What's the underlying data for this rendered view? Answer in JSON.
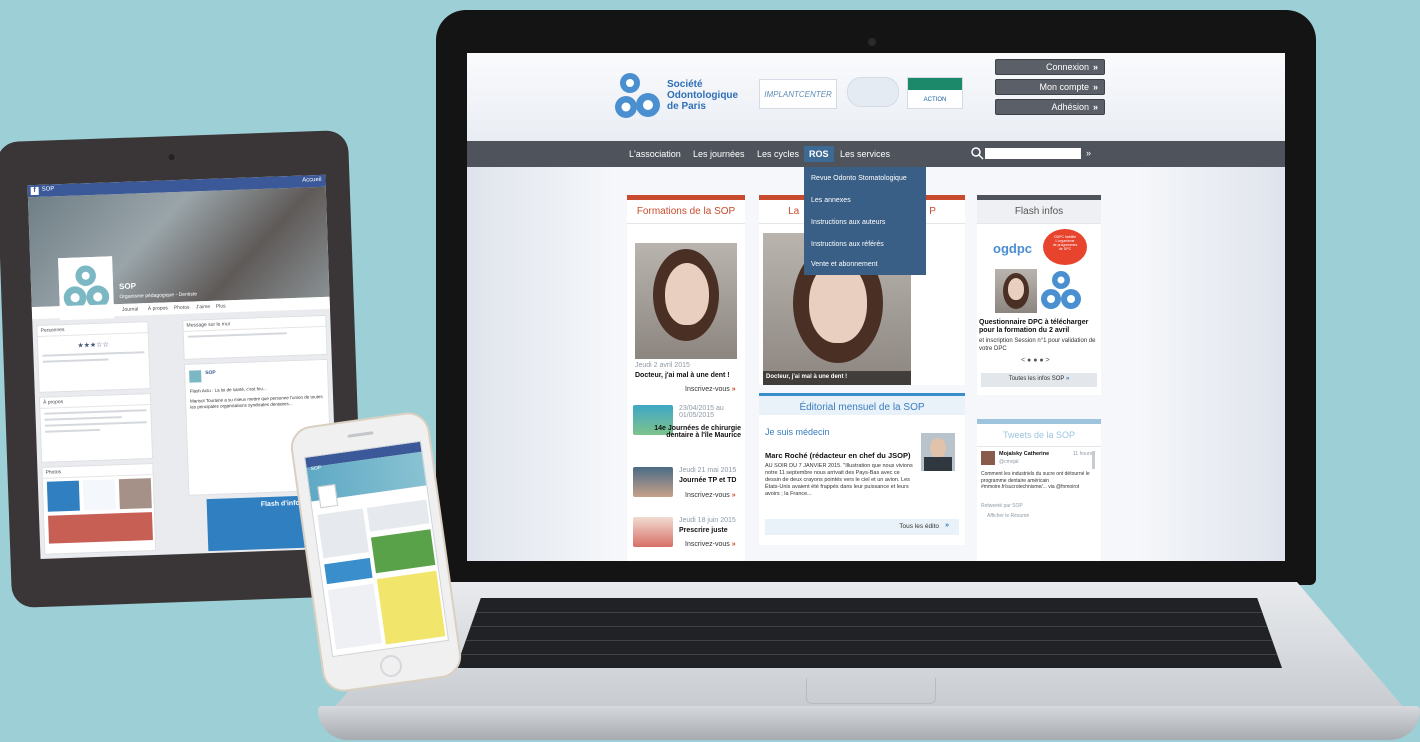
{
  "laptop": {
    "site": {
      "logo_name": "Société\nOdontologique\nde Paris",
      "sponsors": [
        "IMPLANTCENTER",
        "",
        "ACTION"
      ],
      "account_buttons": [
        "Connexion",
        "Mon compte",
        "Adhésion"
      ],
      "nav": [
        "L'association",
        "Les journées",
        "Les cycles",
        "ROS",
        "Les services"
      ],
      "ros_menu": [
        "Revue Odonto Stomatologique",
        "Les annexes",
        "Instructions aux auteurs",
        "Instructions aux référés",
        "Vente et abonnement"
      ],
      "col_left": {
        "heading": "Formations de la SOP",
        "featured_date": "Jeudi 2 avril 2015",
        "featured_title": "Docteur, j'ai mal à une dent !",
        "featured_link": "Inscrivez-vous",
        "events": [
          {
            "date": "23/04/2015 au 01/05/2015",
            "title": "14e Journées de chirurgie dentaire à l'île Maurice",
            "link": ""
          },
          {
            "date": "Jeudi 21 mai 2015",
            "title": "Journée TP et TD",
            "link": "Inscrivez-vous"
          },
          {
            "date": "Jeudi 18 juin 2015",
            "title": "Prescrire juste",
            "link": "Inscrivez-vous"
          }
        ]
      },
      "col_mid": {
        "heading_prefix": "La",
        "heading_suffix": "P",
        "photo_caption": "Docteur, j'ai mal à une dent !",
        "editorial_heading": "Éditorial mensuel de la SOP",
        "editorial_title": "Je suis médecin",
        "editorial_author": "Marc Roché (rédacteur en chef du JSOP)",
        "editorial_text": "AU SOIR DU 7 JANVIER 2015. \"Illustration que nous vivions notre 11 septembre nous arrivait des Pays-Bas avec ce dessin de deux crayons pointés vers le ciel et un avion. Les États-Unis avaient été frappés dans leur puissance et leurs avoirs ; la France...",
        "editorial_link": "Tous les édito"
      },
      "col_right": {
        "heading": "Flash infos",
        "logo_text": "ogdpc",
        "badge_text": "ODPC habilité\nL'organisme\nde programmes\nde DPC",
        "news_title": "Questionnaire DPC à télécharger pour la formation du 2 avril",
        "news_text": "et inscription Session n°1 pour validation de votre DPC",
        "pager": "< ● ● ● >",
        "all_news": "Toutes les infos SOP",
        "tweets_heading": "Tweets de la SOP",
        "tweet_author": "Mojalsky Catherine",
        "tweet_handle": "@cmojal",
        "tweet_time": "11 hours",
        "tweet_text": "Comment les industriels du sucre ont détourné le programme dentaire américain #mmoire.fr/sucrotechnisme/... via @fnmoirot",
        "retweet": "Retweeté par SOP",
        "show_summary": "Afficher le Résumé"
      }
    }
  },
  "tablet": {
    "page_name": "SOP",
    "home": "Accueil",
    "title": "SOP",
    "subtitle": "Organisme pédagogique - Dentiste",
    "tabs": [
      "Journal",
      "À propos",
      "Photos",
      "J'aime",
      "Plus"
    ],
    "rating": "★★★☆☆",
    "cards": [
      "Personnes",
      "À propos",
      "Photos"
    ],
    "composer": "Message sur le mur",
    "post_author": "SOP",
    "post_text": "Flash Actu : La loi de santé, c'est fou...",
    "post_body": "Marisol Touraine a su mieux mettre que personne l'union de toutes les principales organisations syndicales dentaires...",
    "flash_title": "Flash d'informations"
  },
  "phone": {
    "bar": "SOP"
  }
}
